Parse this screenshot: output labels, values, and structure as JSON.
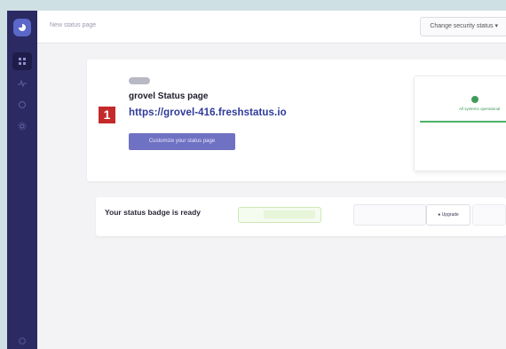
{
  "header": {
    "page_title": "New status page",
    "security_status_label": "Change security status"
  },
  "sidebar": {
    "icons": [
      "logo-icon",
      "dashboard-icon",
      "monitor-icon",
      "incident-icon",
      "settings-icon",
      "help-icon"
    ]
  },
  "status_page": {
    "tag": "",
    "title": "grovel Status page",
    "url": "https://grovel-416.freshstatus.io",
    "customize_label": "Customize your status page"
  },
  "preview": {
    "status_text": "All systems operational"
  },
  "annotation": {
    "number": "1",
    "color": "#c42a2a"
  },
  "badge_card": {
    "title": "Your status badge is ready",
    "badge_left": "",
    "badge_right": "",
    "upgrade_label": "Upgrade"
  },
  "colors": {
    "sidebar": "#2b2a63",
    "accent": "#6f71c2",
    "link": "#2e3a9a",
    "operational": "#3f9b5a"
  }
}
